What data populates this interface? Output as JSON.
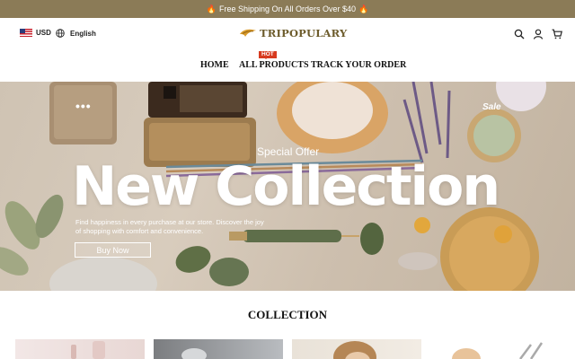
{
  "announcement": {
    "text": "Free Shipping On All Orders Over $40"
  },
  "header": {
    "currency": "USD",
    "language": "English",
    "logo_text": "TRIPOPULARY"
  },
  "nav": {
    "items": [
      {
        "label": "HOME"
      },
      {
        "label": "ALL PRODUCTS",
        "badge": "HOT"
      },
      {
        "label": "TRACK YOUR ORDER"
      }
    ]
  },
  "hero": {
    "sale_label": "Sale",
    "special_offer": "Special Offer",
    "headline": "New Collection",
    "description": "Find happiness in every purchase at our store. Discover the joy of shopping with comfort and convenience.",
    "cta": "Buy Now"
  },
  "collection": {
    "title": "COLLECTION"
  },
  "colors": {
    "accent": "#8b7b57",
    "brand": "#6d5c2c",
    "hot": "#d73a1f"
  },
  "icons": [
    "us-flag-icon",
    "globe-icon",
    "logo-wing-icon",
    "search-icon",
    "user-icon",
    "cart-icon",
    "flame-icon"
  ]
}
